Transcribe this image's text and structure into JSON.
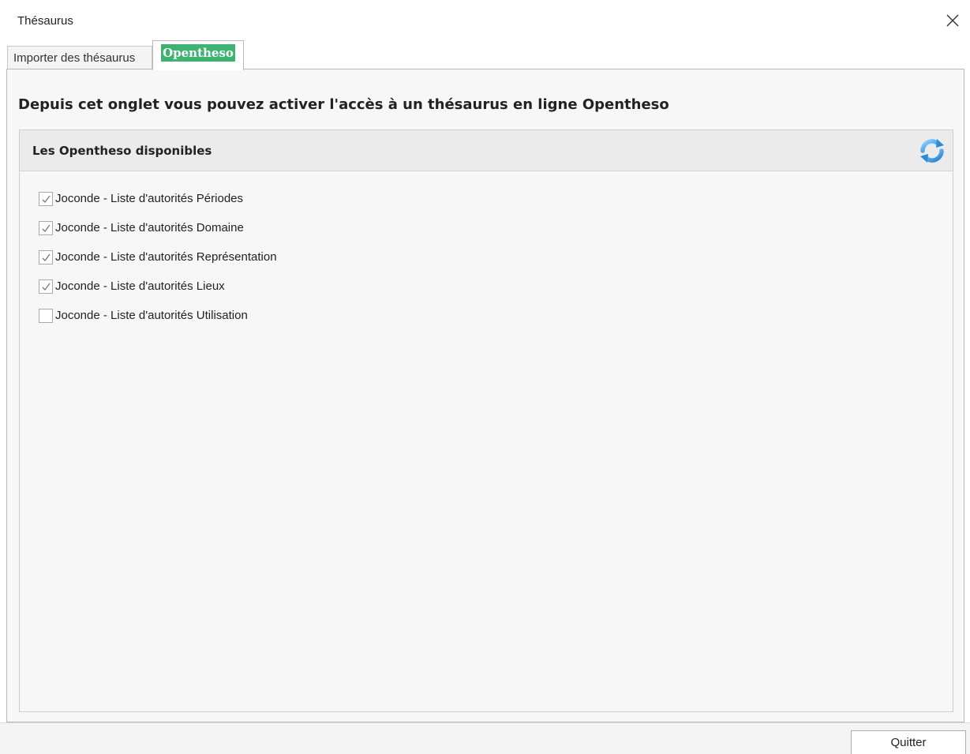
{
  "window": {
    "title": "Thésaurus",
    "close_icon": "close-icon"
  },
  "tabs": [
    {
      "label": "Importer des thésaurus",
      "active": false
    },
    {
      "label": "Opentheso",
      "active": true,
      "badge_color": "#3eb371"
    }
  ],
  "main": {
    "heading": "Depuis cet onglet vous pouvez activer l'accès à un thésaurus en ligne Opentheso",
    "group": {
      "title": "Les Opentheso disponibles",
      "refresh_icon": "refresh-icon",
      "items": [
        {
          "label": "Joconde - Liste d'autorités Périodes",
          "checked": true
        },
        {
          "label": "Joconde - Liste d'autorités Domaine",
          "checked": true
        },
        {
          "label": "Joconde - Liste d'autorités Représentation",
          "checked": true
        },
        {
          "label": "Joconde - Liste d'autorités Lieux",
          "checked": true
        },
        {
          "label": "Joconde - Liste d'autorités Utilisation",
          "checked": false
        }
      ]
    }
  },
  "footer": {
    "quit_label": "Quitter"
  }
}
